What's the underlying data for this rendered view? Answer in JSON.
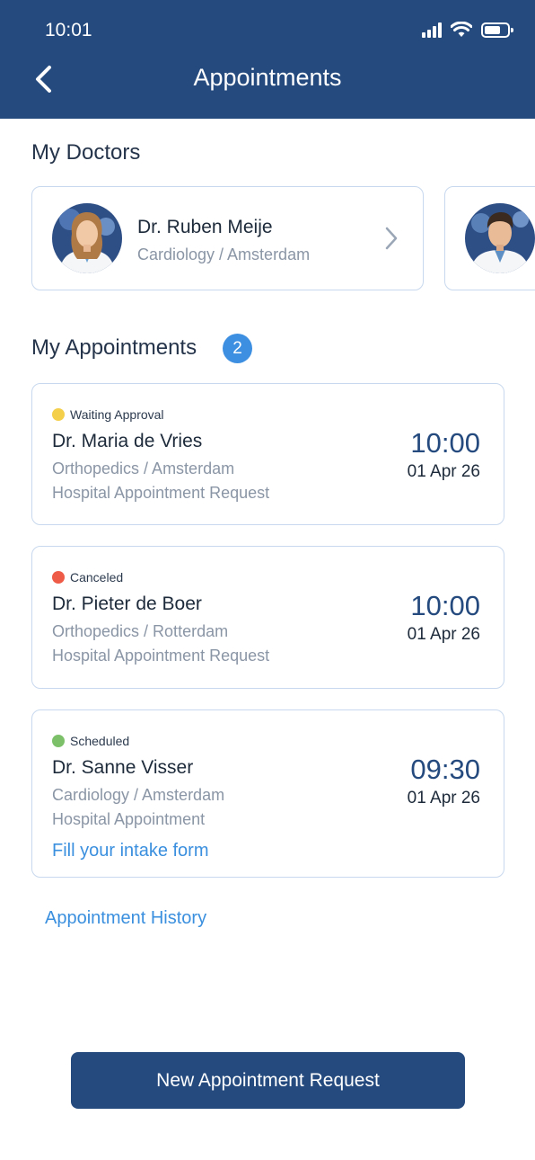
{
  "status_bar": {
    "time": "10:01"
  },
  "header": {
    "title": "Appointments"
  },
  "doctors_section": {
    "title": "My Doctors",
    "doctors": [
      {
        "name": "Dr. Ruben Meije",
        "specialty": "Cardiology / Amsterdam"
      }
    ]
  },
  "appointments_section": {
    "title": "My Appointments",
    "count": "2",
    "items": [
      {
        "status": "Waiting Approval",
        "status_color": "#f4cf4a",
        "doctor": "Dr. Maria de Vries",
        "specialty": "Orthopedics / Amsterdam",
        "type": "Hospital Appointment Request",
        "time": "10:00",
        "date": "01 Apr 26"
      },
      {
        "status": "Canceled",
        "status_color": "#ee5b47",
        "doctor": "Dr. Pieter de Boer",
        "specialty": "Orthopedics / Rotterdam",
        "type": "Hospital Appointment Request",
        "time": "10:00",
        "date": "01 Apr 26"
      },
      {
        "status": "Scheduled",
        "status_color": "#7cc16a",
        "doctor": "Dr. Sanne Visser",
        "specialty": "Cardiology / Amsterdam",
        "type": "Hospital Appointment",
        "time": "09:30",
        "date": "01 Apr 26",
        "action_link": "Fill your intake form"
      }
    ]
  },
  "history_link": "Appointment History",
  "new_appointment_button": "New Appointment Request",
  "colors": {
    "header": "#244a7e",
    "accent": "#3a8fde",
    "badge": "#3d8fe2"
  }
}
